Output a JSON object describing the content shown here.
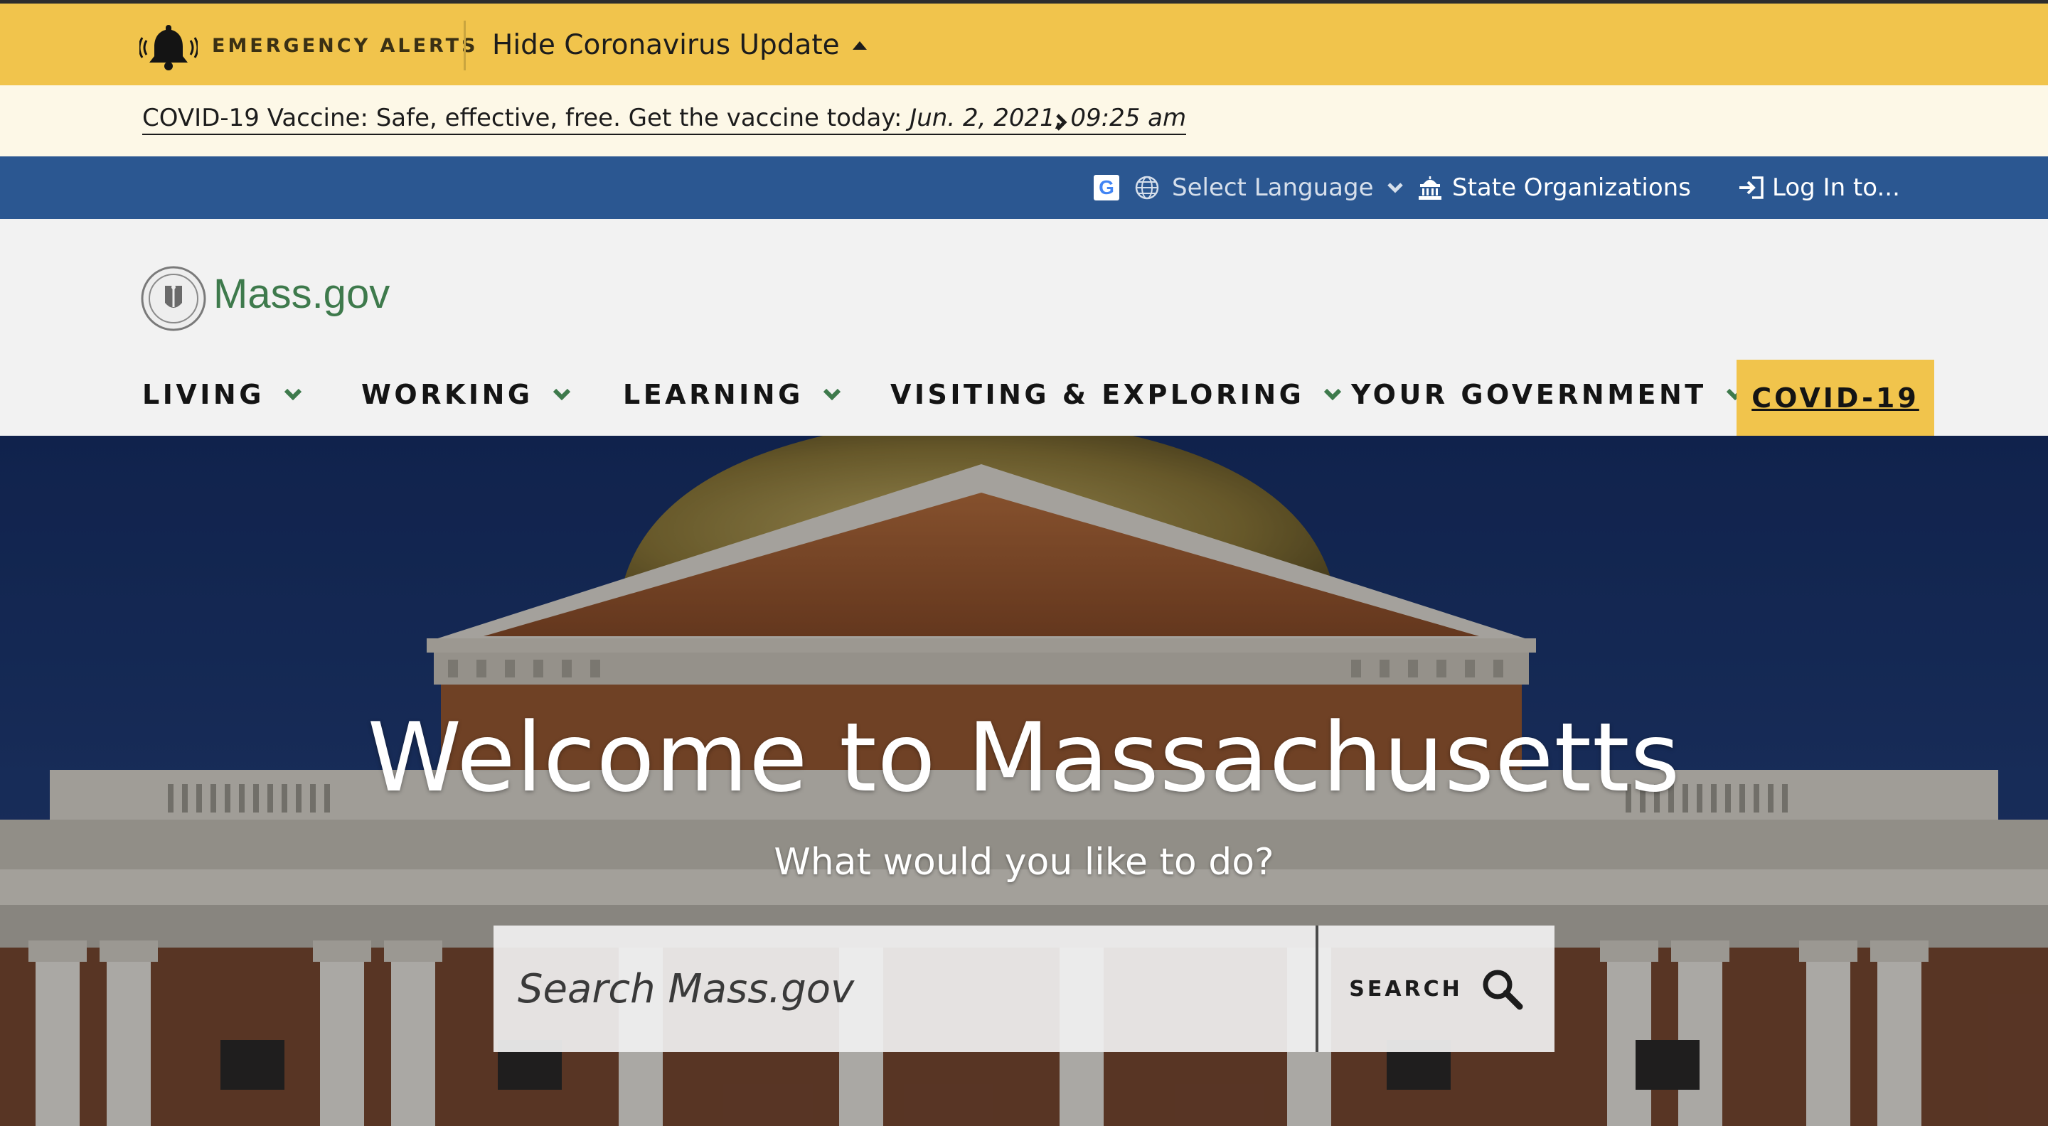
{
  "alerts": {
    "label": "EMERGENCY ALERTS",
    "toggle_label": "Hide Coronavirus Update",
    "icon": "bell-icon",
    "bg_color": "#f1c44c"
  },
  "vaccine_banner": {
    "text": "COVID-19 Vaccine: Safe, effective, free. Get the vaccine today: ",
    "date": "Jun. 2, 2021, 09:25 am",
    "icon": "chevron-right-icon"
  },
  "utility_nav": {
    "language": "Select Language",
    "organizations": "State Organizations",
    "login": "Log In to...",
    "bg_color": "#2b5791"
  },
  "header": {
    "brand": "Mass.gov",
    "brand_color": "#3e7a4c"
  },
  "main_nav": {
    "items": [
      {
        "label": "LIVING"
      },
      {
        "label": "WORKING"
      },
      {
        "label": "LEARNING"
      },
      {
        "label": "VISITING & EXPLORING"
      },
      {
        "label": "YOUR GOVERNMENT"
      }
    ],
    "covid": "COVID-19"
  },
  "hero": {
    "title": "Welcome to Massachusetts",
    "subtitle": "What would you like to do?",
    "search_placeholder": "Search Mass.gov",
    "search_button": "SEARCH"
  }
}
